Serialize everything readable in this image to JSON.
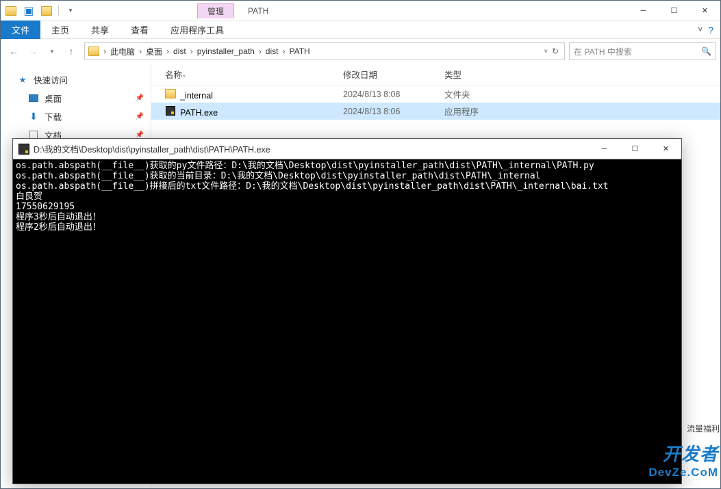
{
  "explorer": {
    "title": "PATH",
    "manage_tab": "管理",
    "ribbon": {
      "file": "文件",
      "home": "主页",
      "share": "共享",
      "view": "查看",
      "apptool": "应用程序工具",
      "expand_tip": "^"
    },
    "breadcrumbs": [
      "此电脑",
      "桌面",
      "dist",
      "pyinstaller_path",
      "dist",
      "PATH"
    ],
    "search_placeholder": "在 PATH 中搜索",
    "sidebar": {
      "quick": "快速访问",
      "desktop": "桌面",
      "downloads": "下载",
      "documents": "文档"
    },
    "columns": {
      "name": "名称",
      "date": "修改日期",
      "type": "类型"
    },
    "rows": [
      {
        "name": "_internal",
        "date": "2024/8/13 8:08",
        "type": "文件夹",
        "selected": false,
        "icon": "folder"
      },
      {
        "name": "PATH.exe",
        "date": "2024/8/13 8:06",
        "type": "应用程序",
        "selected": true,
        "icon": "exe"
      }
    ]
  },
  "console": {
    "title": "D:\\我的文档\\Desktop\\dist\\pyinstaller_path\\dist\\PATH\\PATH.exe",
    "lines": [
      "os.path.abspath(__file__)获取的py文件路径：D:\\我的文档\\Desktop\\dist\\pyinstaller_path\\dist\\PATH\\_internal\\PATH.py",
      "os.path.abspath(__file__)获取的当前目录：D:\\我的文档\\Desktop\\dist\\pyinstaller_path\\dist\\PATH\\_internal",
      "os.path.abspath(__file__)拼接后的txt文件路径：D:\\我的文档\\Desktop\\dist\\pyinstaller_path\\dist\\PATH\\_internal\\bai.txt",
      "白良贺",
      "17550629195",
      "程序3秒后自动退出！",
      "程序2秒后自动退出！"
    ]
  },
  "watermark": {
    "l1": "开发者",
    "l2": "DevZe.CoM"
  },
  "misc": {
    "side": "流量福利",
    "left_frag": "文"
  }
}
